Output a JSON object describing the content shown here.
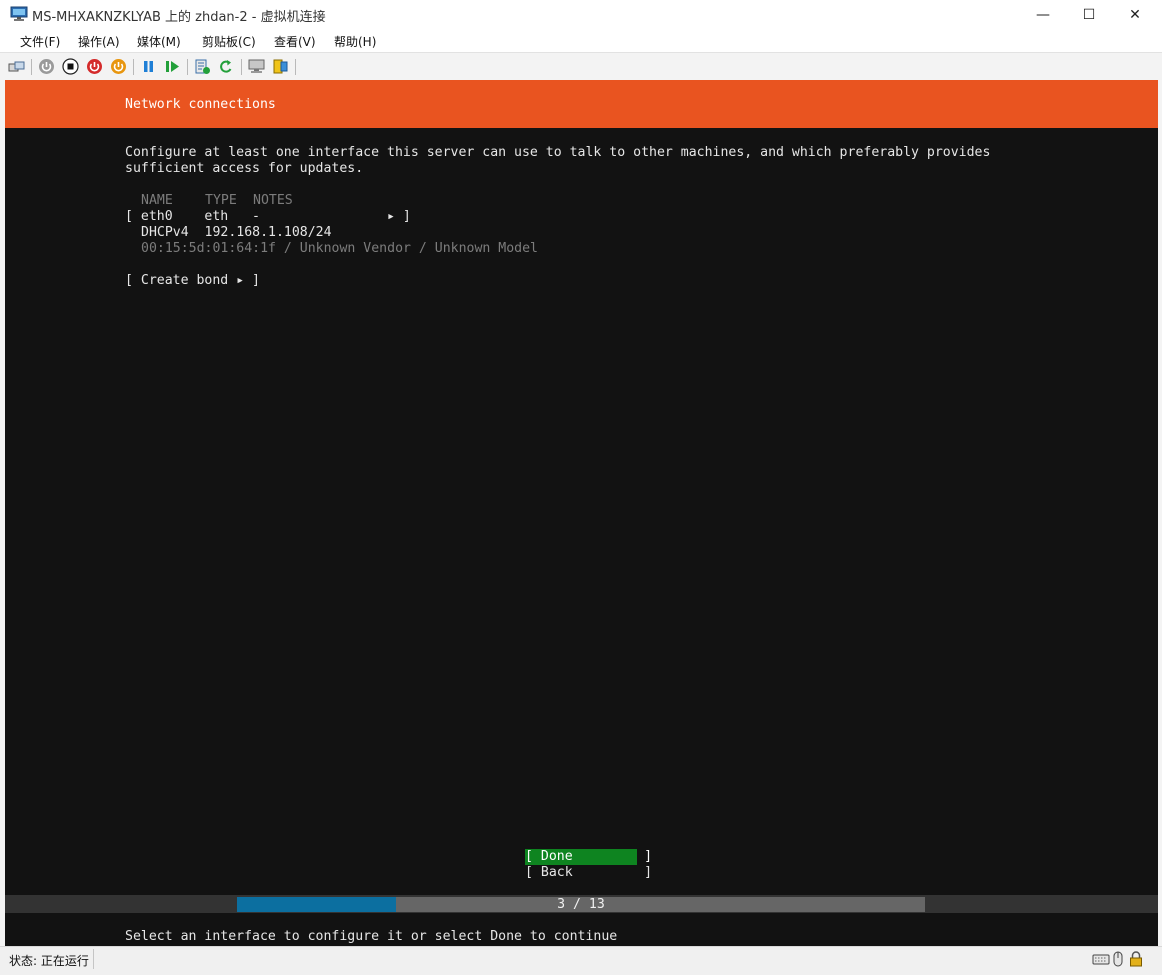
{
  "window": {
    "title": "MS-MHXAKNZKLYAB 上的 zhdan-2 - 虚拟机连接",
    "minimize_glyph": "—",
    "maximize_glyph": "☐",
    "close_glyph": "✕"
  },
  "menu": [
    "文件(F)",
    "操作(A)",
    "媒体(M)",
    "剪贴板(C)",
    "查看(V)",
    "帮助(H)"
  ],
  "toolbar": {
    "icons": [
      "ctrl-alt-del-icon",
      "start-icon",
      "turn-off-icon",
      "shutdown-icon",
      "save-icon",
      "pause-icon",
      "resume-icon",
      "checkpoint-icon",
      "revert-icon",
      "enhanced-session-icon",
      "share-icon"
    ]
  },
  "installer": {
    "header": "Network connections",
    "intro_line1": "Configure at least one interface this server can use to talk to other machines, and which preferably provides",
    "intro_line2": "sufficient access for updates.",
    "columns": {
      "name": "NAME",
      "type": "TYPE",
      "notes": "NOTES"
    },
    "interface": {
      "row": "[ eth0    eth   -                ▸ ]",
      "address": "DHCPv4  192.168.1.108/24",
      "details": "00:15:5d:01:64:1f / Unknown Vendor / Unknown Model"
    },
    "create_bond": "[ Create bond ▸ ]",
    "done": "[ Done         ]",
    "back": "[ Back         ]",
    "progress": {
      "text": "3 / 13",
      "current": 3,
      "total": 13
    },
    "footer": "Select an interface to configure it or select Done to continue"
  },
  "status": {
    "label": "状态: 正在运行"
  },
  "colors": {
    "header_orange": "#e95420",
    "terminal_bg": "#121212",
    "done_green": "#0e8420",
    "progress_blue": "#0c6fa0",
    "progress_track": "#666666"
  }
}
